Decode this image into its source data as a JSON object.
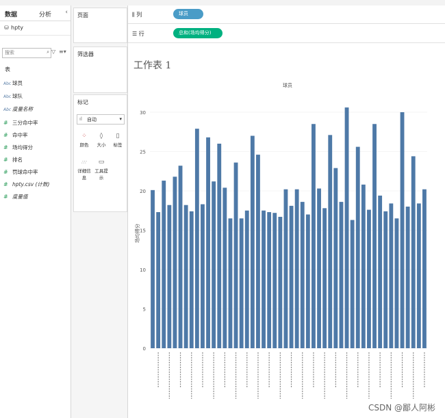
{
  "data_pane": {
    "tabs": [
      "数据",
      "分析"
    ],
    "collapse_icon": "chevron-left",
    "source": "hpty",
    "search_placeholder": "搜索",
    "tables_header": "表",
    "fields": [
      {
        "name": "球员",
        "type": "Abc"
      },
      {
        "name": "球队",
        "type": "Abc"
      },
      {
        "name": "度量名称",
        "type": "Abc",
        "italic": true
      },
      {
        "name": "三分命中率",
        "type": "#"
      },
      {
        "name": "命中率",
        "type": "#"
      },
      {
        "name": "场均得分",
        "type": "#"
      },
      {
        "name": "排名",
        "type": "#"
      },
      {
        "name": "罚球命中率",
        "type": "#"
      },
      {
        "name": "hpty.csv (计数)",
        "type": "#",
        "italic": true
      },
      {
        "name": "度量值",
        "type": "#",
        "italic": true
      }
    ]
  },
  "cards": {
    "pages": "页面",
    "filters": "筛选器",
    "marks": "标记",
    "mark_type": "自动",
    "mark_buttons": [
      "颜色",
      "大小",
      "标签",
      "详细信息",
      "工具提示"
    ]
  },
  "shelves": {
    "columns_label": "列",
    "columns_pill": "球员",
    "rows_label": "行",
    "rows_pill": "总和(场均得分)"
  },
  "sheet_title": "工作表 1",
  "watermark": "CSDN @鄙人阿彬",
  "colors": {
    "bar": "#4e79a7",
    "dimension_pill": "#4a9cc7",
    "measure_pill": "#00b180"
  },
  "chart_data": {
    "type": "bar",
    "title": "",
    "xlabel": "球员",
    "ylabel": "场均得分",
    "ylim": [
      0,
      32
    ],
    "yticks": [
      0,
      5,
      10,
      15,
      20,
      25,
      30
    ],
    "series": [
      {
        "values": [
          20.1,
          17.3,
          21.3,
          18.2,
          21.8,
          23.2,
          18.2,
          17.4,
          27.9,
          18.3,
          26.8,
          21.2,
          26.0,
          20.4,
          16.5,
          23.6,
          16.5,
          17.5,
          27.0,
          24.6,
          17.5,
          17.3,
          17.2,
          16.7,
          20.2,
          18.1,
          20.2,
          18.6,
          17.0,
          28.5,
          20.3,
          17.8,
          27.1,
          22.9,
          18.6,
          30.6,
          16.3,
          25.6,
          20.8,
          17.6,
          28.5,
          19.4,
          17.4,
          18.4,
          16.5,
          30.0,
          18.0,
          24.4,
          18.4,
          20.2
        ]
      }
    ]
  }
}
